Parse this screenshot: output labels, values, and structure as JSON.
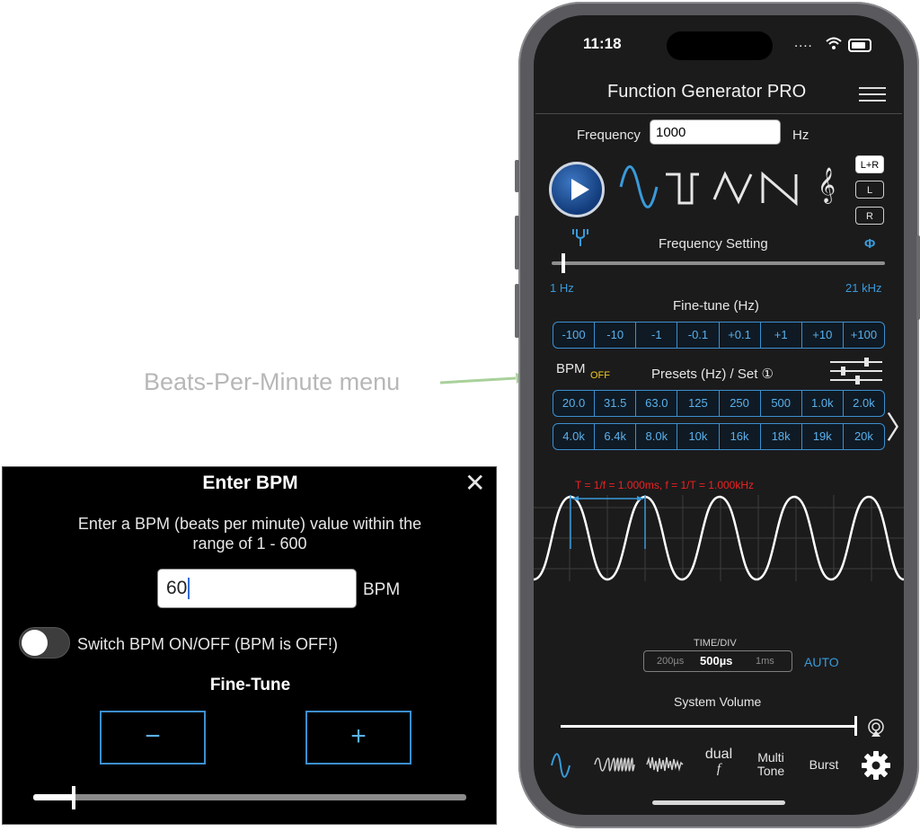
{
  "callout": {
    "text": "Beats-Per-Minute menu"
  },
  "status": {
    "time": "11:18",
    "signal": "....",
    "wifi": "wifi-icon"
  },
  "header": {
    "title": "Function Generator PRO",
    "menu_icon": "hamburger-menu-icon"
  },
  "frequency": {
    "label": "Frequency",
    "value": "1000",
    "unit": "Hz"
  },
  "waveforms": [
    "sine-wave-icon",
    "square-wave-icon",
    "triangle-wave-icon",
    "sawtooth-wave-icon"
  ],
  "channels": [
    "L+R",
    "L",
    "R"
  ],
  "frequency_setting": {
    "label": "Frequency Setting",
    "phase_symbol": "Φ",
    "min_label": "1 Hz",
    "max_label": "21 kHz",
    "position_fraction": 0.02
  },
  "fine_tune": {
    "label": "Fine-tune (Hz)",
    "buttons": [
      "-100",
      "-10",
      "-1",
      "-0.1",
      "+0.1",
      "+1",
      "+10",
      "+100"
    ]
  },
  "bpm": {
    "label": "BPM",
    "state": "OFF"
  },
  "presets": {
    "label": "Presets (Hz) / Set ①",
    "row1": [
      "20.0",
      "31.5",
      "63.0",
      "125",
      "250",
      "500",
      "1.0k",
      "2.0k"
    ],
    "row2": [
      "4.0k",
      "6.4k",
      "8.0k",
      "10k",
      "16k",
      "18k",
      "19k",
      "20k"
    ],
    "next_symbol": "〉"
  },
  "scope": {
    "annotation": "T = 1/f = 1.000ms, f = 1/T = 1.000kHz"
  },
  "time_div": {
    "label": "TIME/DIV",
    "prev": "200µs",
    "current": "500µs",
    "next": "1ms",
    "mode": "AUTO"
  },
  "volume": {
    "label": "System Volume",
    "level_fraction": 0.99
  },
  "tabs": {
    "dual": "dual",
    "dual_sub": "f",
    "multi_line1": "Multi",
    "multi_line2": "Tone",
    "burst": "Burst"
  },
  "dialog": {
    "title": "Enter BPM",
    "description": "Enter a BPM (beats per minute) value within the range of 1 - 600",
    "input_value": "60",
    "unit": "BPM",
    "toggle_label": "Switch BPM ON/OFF (BPM is OFF!)",
    "toggle_on": false,
    "fine_tune_title": "Fine-Tune",
    "minus": "−",
    "plus": "+",
    "close": "✕",
    "slider_fraction": 0.09
  },
  "colors": {
    "accent": "#3a9ad9",
    "bpm_off": "#f2c91d",
    "annotation": "#e22222"
  }
}
